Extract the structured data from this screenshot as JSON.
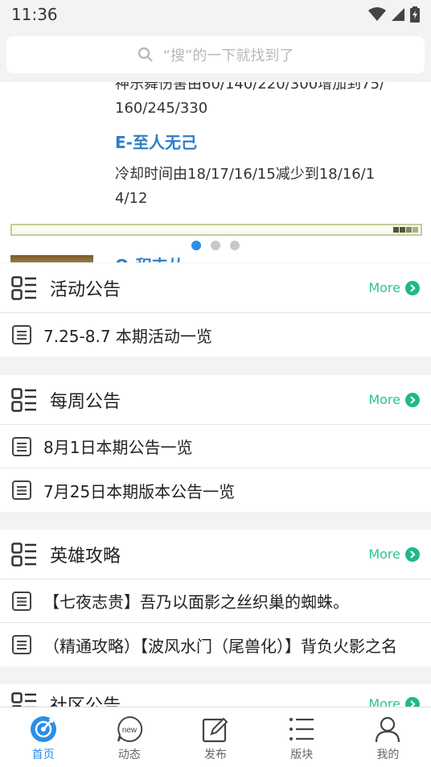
{
  "status": {
    "time": "11:36"
  },
  "search": {
    "placeholder": "“搜”的一下就找到了"
  },
  "banner": {
    "lines_top": [
      "神乐舞伤害由60/140/220/300增加到75/",
      "160/245/330"
    ],
    "heading": "E-至人无己",
    "lines_bottom": [
      "冷却时间由18/17/16/15减少到18/16/1",
      "4/12"
    ],
    "next_heading": "Q-积支从",
    "dots": [
      true,
      false,
      false
    ]
  },
  "sections": [
    {
      "title": "活动公告",
      "more": "More",
      "items": [
        "7.25-8.7 本期活动一览"
      ]
    },
    {
      "title": "每周公告",
      "more": "More",
      "items": [
        "8月1日本期公告一览",
        "7月25日本期版本公告一览"
      ]
    },
    {
      "title": "英雄攻略",
      "more": "More",
      "items": [
        "【七夜志贵】吾乃以面影之丝织巢的蜘蛛。",
        "（精通攻略）【波风水门（尾兽化）】背负火影之名"
      ]
    },
    {
      "title": "社区公告",
      "more": "More",
      "items": []
    }
  ],
  "tabs": [
    {
      "label": "首页",
      "icon": "home-icon",
      "active": true
    },
    {
      "label": "动态",
      "icon": "news-icon",
      "active": false
    },
    {
      "label": "发布",
      "icon": "edit-icon",
      "active": false
    },
    {
      "label": "版块",
      "icon": "list-icon",
      "active": false
    },
    {
      "label": "我的",
      "icon": "user-icon",
      "active": false
    }
  ],
  "colors": {
    "accent": "#2a8ee8",
    "more": "#1fb88c",
    "banner_head": "#2c7fc9"
  }
}
